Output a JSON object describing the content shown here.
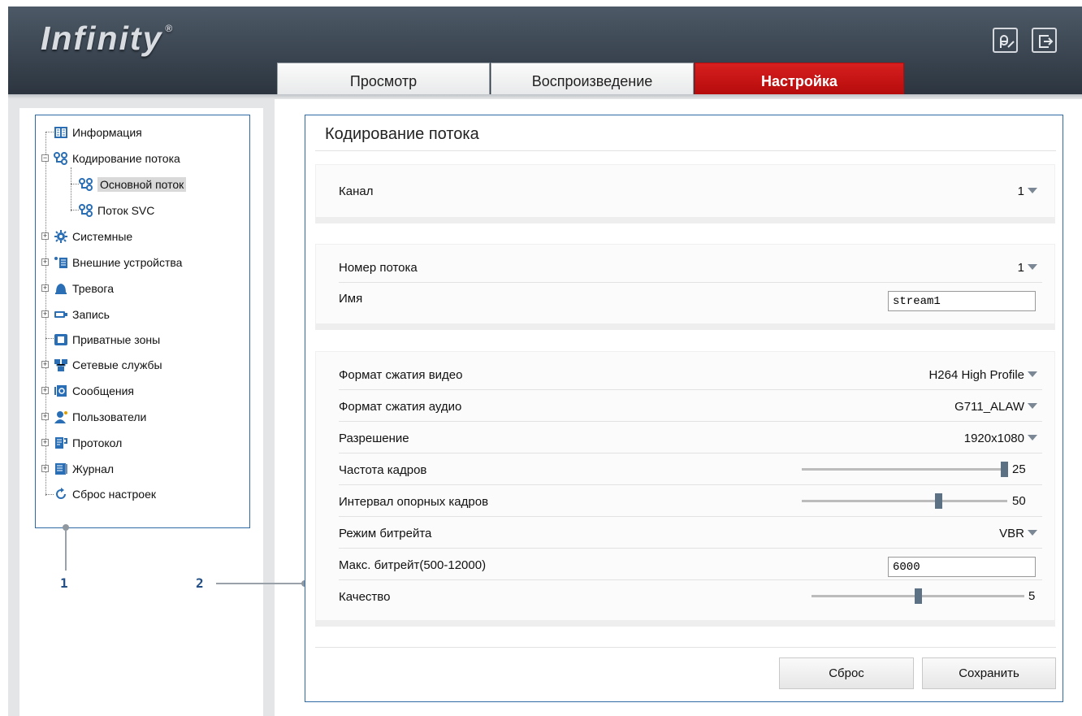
{
  "header": {
    "logo": "Infinity",
    "logo_mark": "®",
    "icons": [
      "user-edit-icon",
      "logout-icon"
    ]
  },
  "tabs": [
    {
      "label": "Просмотр",
      "active": false
    },
    {
      "label": "Воспроизведение",
      "active": false
    },
    {
      "label": "Настройка",
      "active": true
    }
  ],
  "colors": {
    "accent": "#c41414",
    "header": "#3a4551",
    "frame": "#2f6aa5"
  },
  "sidebar": {
    "items": [
      {
        "label": "Информация",
        "icon": "info-icon"
      },
      {
        "label": "Кодирование потока",
        "icon": "stream-icon",
        "expanded": true
      },
      {
        "label": "Основной поток",
        "icon": "stream-icon",
        "selected": true
      },
      {
        "label": "Поток SVC",
        "icon": "stream-icon"
      },
      {
        "label": "Системные",
        "icon": "gear-icon"
      },
      {
        "label": "Внешние устройства",
        "icon": "device-icon"
      },
      {
        "label": "Тревога",
        "icon": "alarm-icon"
      },
      {
        "label": "Запись",
        "icon": "record-icon"
      },
      {
        "label": "Приватные зоны",
        "icon": "privacy-icon"
      },
      {
        "label": "Сетевые службы",
        "icon": "network-icon"
      },
      {
        "label": "Сообщения",
        "icon": "message-icon"
      },
      {
        "label": "Пользователи",
        "icon": "users-icon"
      },
      {
        "label": "Протокол",
        "icon": "protocol-icon"
      },
      {
        "label": "Журнал",
        "icon": "log-icon"
      },
      {
        "label": "Сброс настроек",
        "icon": "reset-icon"
      }
    ]
  },
  "main": {
    "title": "Кодирование потока",
    "channel": {
      "label": "Канал",
      "value": "1"
    },
    "stream_number": {
      "label": "Номер потока",
      "value": "1"
    },
    "name": {
      "label": "Имя",
      "value": "stream1"
    },
    "video_format": {
      "label": "Формат сжатия видео",
      "value": "H264 High Profile"
    },
    "audio_format": {
      "label": "Формат сжатия аудио",
      "value": "G711_ALAW"
    },
    "resolution": {
      "label": "Разрешение",
      "value": "1920x1080"
    },
    "frame_rate": {
      "label": "Частота кадров",
      "value": "25",
      "level": 1.0
    },
    "gop": {
      "label": "Интервал опорных кадров",
      "value": "50",
      "level": 0.67
    },
    "bitrate_mode": {
      "label": "Режим битрейта",
      "value": "VBR"
    },
    "max_bitrate": {
      "label": "Макс. битрейт(500-12000)",
      "value": "6000"
    },
    "quality": {
      "label": "Качество",
      "value": "5",
      "level": 0.5
    },
    "buttons": {
      "reset": "Сброс",
      "save": "Сохранить"
    }
  },
  "callouts": [
    "1",
    "2"
  ]
}
